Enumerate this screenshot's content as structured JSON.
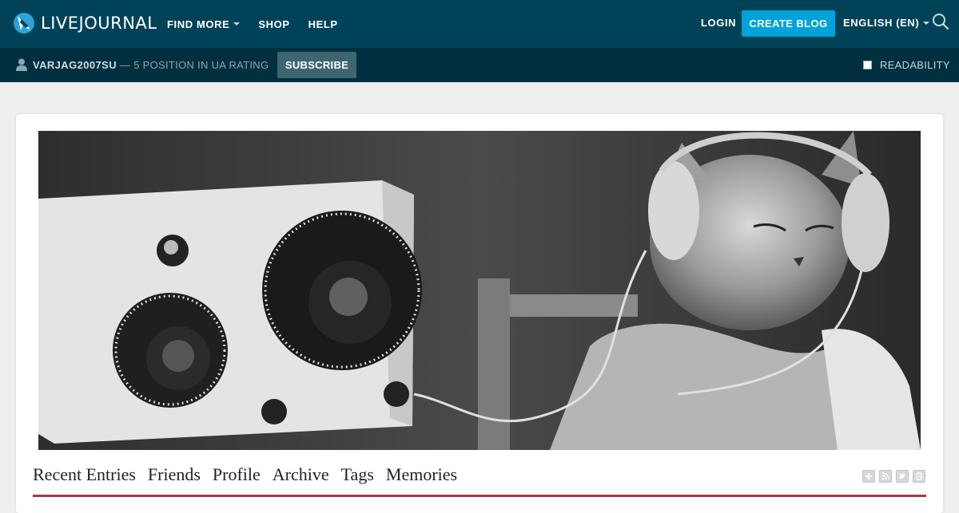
{
  "brand": {
    "name": "LIVEJOURNAL"
  },
  "topnav": {
    "items": [
      {
        "label": "FIND MORE",
        "dropdown": true
      },
      {
        "label": "SHOP",
        "dropdown": false
      },
      {
        "label": "HELP",
        "dropdown": false
      }
    ],
    "login_label": "LOGIN",
    "create_blog_label": "CREATE BLOG",
    "language_label": "ENGLISH (EN)"
  },
  "journal_bar": {
    "username": "VARJAG2007SU",
    "rating_text": "— 5 POSITION IN UA RATING",
    "subscribe_label": "SUBSCRIBE",
    "readability_label": "READABILITY",
    "readability_checked": false
  },
  "journal": {
    "tabs": [
      "Recent Entries",
      "Friends",
      "Profile",
      "Archive",
      "Tags",
      "Memories"
    ],
    "tool_icons": [
      "add-icon",
      "rss-icon",
      "twitter-icon",
      "blogger-icon"
    ]
  },
  "colors": {
    "topbar": "#004359",
    "subbar": "#00303f",
    "accent": "#00a3d9",
    "rule": "#a9383f"
  }
}
